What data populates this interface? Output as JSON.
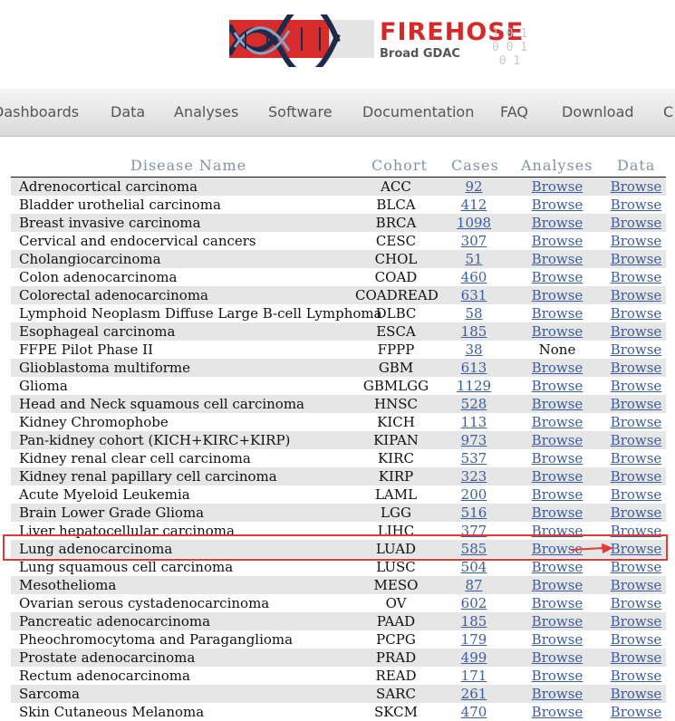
{
  "logo": {
    "title": "FIREHOSE",
    "subtitle": "Broad GDAC"
  },
  "nav": {
    "items": [
      "Dashboards",
      "Data",
      "Analyses",
      "Software",
      "Documentation",
      "FAQ",
      "Download",
      "C"
    ]
  },
  "table": {
    "headers": {
      "disease": "Disease Name",
      "cohort": "Cohort",
      "cases": "Cases",
      "analyses": "Analyses",
      "data": "Data"
    },
    "rows": [
      {
        "name": "Adrenocortical carcinoma",
        "cohort": "ACC",
        "cases": "92",
        "analyses": "Browse",
        "data": "Browse"
      },
      {
        "name": "Bladder urothelial carcinoma",
        "cohort": "BLCA",
        "cases": "412",
        "analyses": "Browse",
        "data": "Browse"
      },
      {
        "name": "Breast invasive carcinoma",
        "cohort": "BRCA",
        "cases": "1098",
        "analyses": "Browse",
        "data": "Browse"
      },
      {
        "name": "Cervical and endocervical cancers",
        "cohort": "CESC",
        "cases": "307",
        "analyses": "Browse",
        "data": "Browse"
      },
      {
        "name": "Cholangiocarcinoma",
        "cohort": "CHOL",
        "cases": "51",
        "analyses": "Browse",
        "data": "Browse"
      },
      {
        "name": "Colon adenocarcinoma",
        "cohort": "COAD",
        "cases": "460",
        "analyses": "Browse",
        "data": "Browse"
      },
      {
        "name": "Colorectal adenocarcinoma",
        "cohort": "COADREAD",
        "cases": "631",
        "analyses": "Browse",
        "data": "Browse"
      },
      {
        "name": "Lymphoid Neoplasm Diffuse Large B-cell Lymphoma",
        "cohort": "DLBC",
        "cases": "58",
        "analyses": "Browse",
        "data": "Browse"
      },
      {
        "name": "Esophageal carcinoma",
        "cohort": "ESCA",
        "cases": "185",
        "analyses": "Browse",
        "data": "Browse"
      },
      {
        "name": "FFPE Pilot Phase II",
        "cohort": "FPPP",
        "cases": "38",
        "analyses": "None",
        "data": "Browse"
      },
      {
        "name": "Glioblastoma multiforme",
        "cohort": "GBM",
        "cases": "613",
        "analyses": "Browse",
        "data": "Browse"
      },
      {
        "name": "Glioma",
        "cohort": "GBMLGG",
        "cases": "1129",
        "analyses": "Browse",
        "data": "Browse"
      },
      {
        "name": "Head and Neck squamous cell carcinoma",
        "cohort": "HNSC",
        "cases": "528",
        "analyses": "Browse",
        "data": "Browse"
      },
      {
        "name": "Kidney Chromophobe",
        "cohort": "KICH",
        "cases": "113",
        "analyses": "Browse",
        "data": "Browse"
      },
      {
        "name": "Pan-kidney cohort (KICH+KIRC+KIRP)",
        "cohort": "KIPAN",
        "cases": "973",
        "analyses": "Browse",
        "data": "Browse"
      },
      {
        "name": "Kidney renal clear cell carcinoma",
        "cohort": "KIRC",
        "cases": "537",
        "analyses": "Browse",
        "data": "Browse"
      },
      {
        "name": "Kidney renal papillary cell carcinoma",
        "cohort": "KIRP",
        "cases": "323",
        "analyses": "Browse",
        "data": "Browse"
      },
      {
        "name": "Acute Myeloid Leukemia",
        "cohort": "LAML",
        "cases": "200",
        "analyses": "Browse",
        "data": "Browse"
      },
      {
        "name": "Brain Lower Grade Glioma",
        "cohort": "LGG",
        "cases": "516",
        "analyses": "Browse",
        "data": "Browse"
      },
      {
        "name": "Liver hepatocellular carcinoma",
        "cohort": "LIHC",
        "cases": "377",
        "analyses": "Browse",
        "data": "Browse"
      },
      {
        "name": "Lung adenocarcinoma",
        "cohort": "LUAD",
        "cases": "585",
        "analyses": "Browse",
        "data": "Browse"
      },
      {
        "name": "Lung squamous cell carcinoma",
        "cohort": "LUSC",
        "cases": "504",
        "analyses": "Browse",
        "data": "Browse"
      },
      {
        "name": "Mesothelioma",
        "cohort": "MESO",
        "cases": "87",
        "analyses": "Browse",
        "data": "Browse"
      },
      {
        "name": "Ovarian serous cystadenocarcinoma",
        "cohort": "OV",
        "cases": "602",
        "analyses": "Browse",
        "data": "Browse"
      },
      {
        "name": "Pancreatic adenocarcinoma",
        "cohort": "PAAD",
        "cases": "185",
        "analyses": "Browse",
        "data": "Browse"
      },
      {
        "name": "Pheochromocytoma and Paraganglioma",
        "cohort": "PCPG",
        "cases": "179",
        "analyses": "Browse",
        "data": "Browse"
      },
      {
        "name": "Prostate adenocarcinoma",
        "cohort": "PRAD",
        "cases": "499",
        "analyses": "Browse",
        "data": "Browse"
      },
      {
        "name": "Rectum adenocarcinoma",
        "cohort": "READ",
        "cases": "171",
        "analyses": "Browse",
        "data": "Browse"
      },
      {
        "name": "Sarcoma",
        "cohort": "SARC",
        "cases": "261",
        "analyses": "Browse",
        "data": "Browse"
      },
      {
        "name": "Skin Cutaneous Melanoma",
        "cohort": "SKCM",
        "cases": "470",
        "analyses": "Browse",
        "data": "Browse"
      }
    ]
  },
  "annotation": {
    "highlight_color": "#e53935"
  },
  "colors": {
    "link": "#3b5da3",
    "header_text": "#7f95a5",
    "row_stripe": "#e6e6e6",
    "logo_red": "#d42a2a"
  }
}
